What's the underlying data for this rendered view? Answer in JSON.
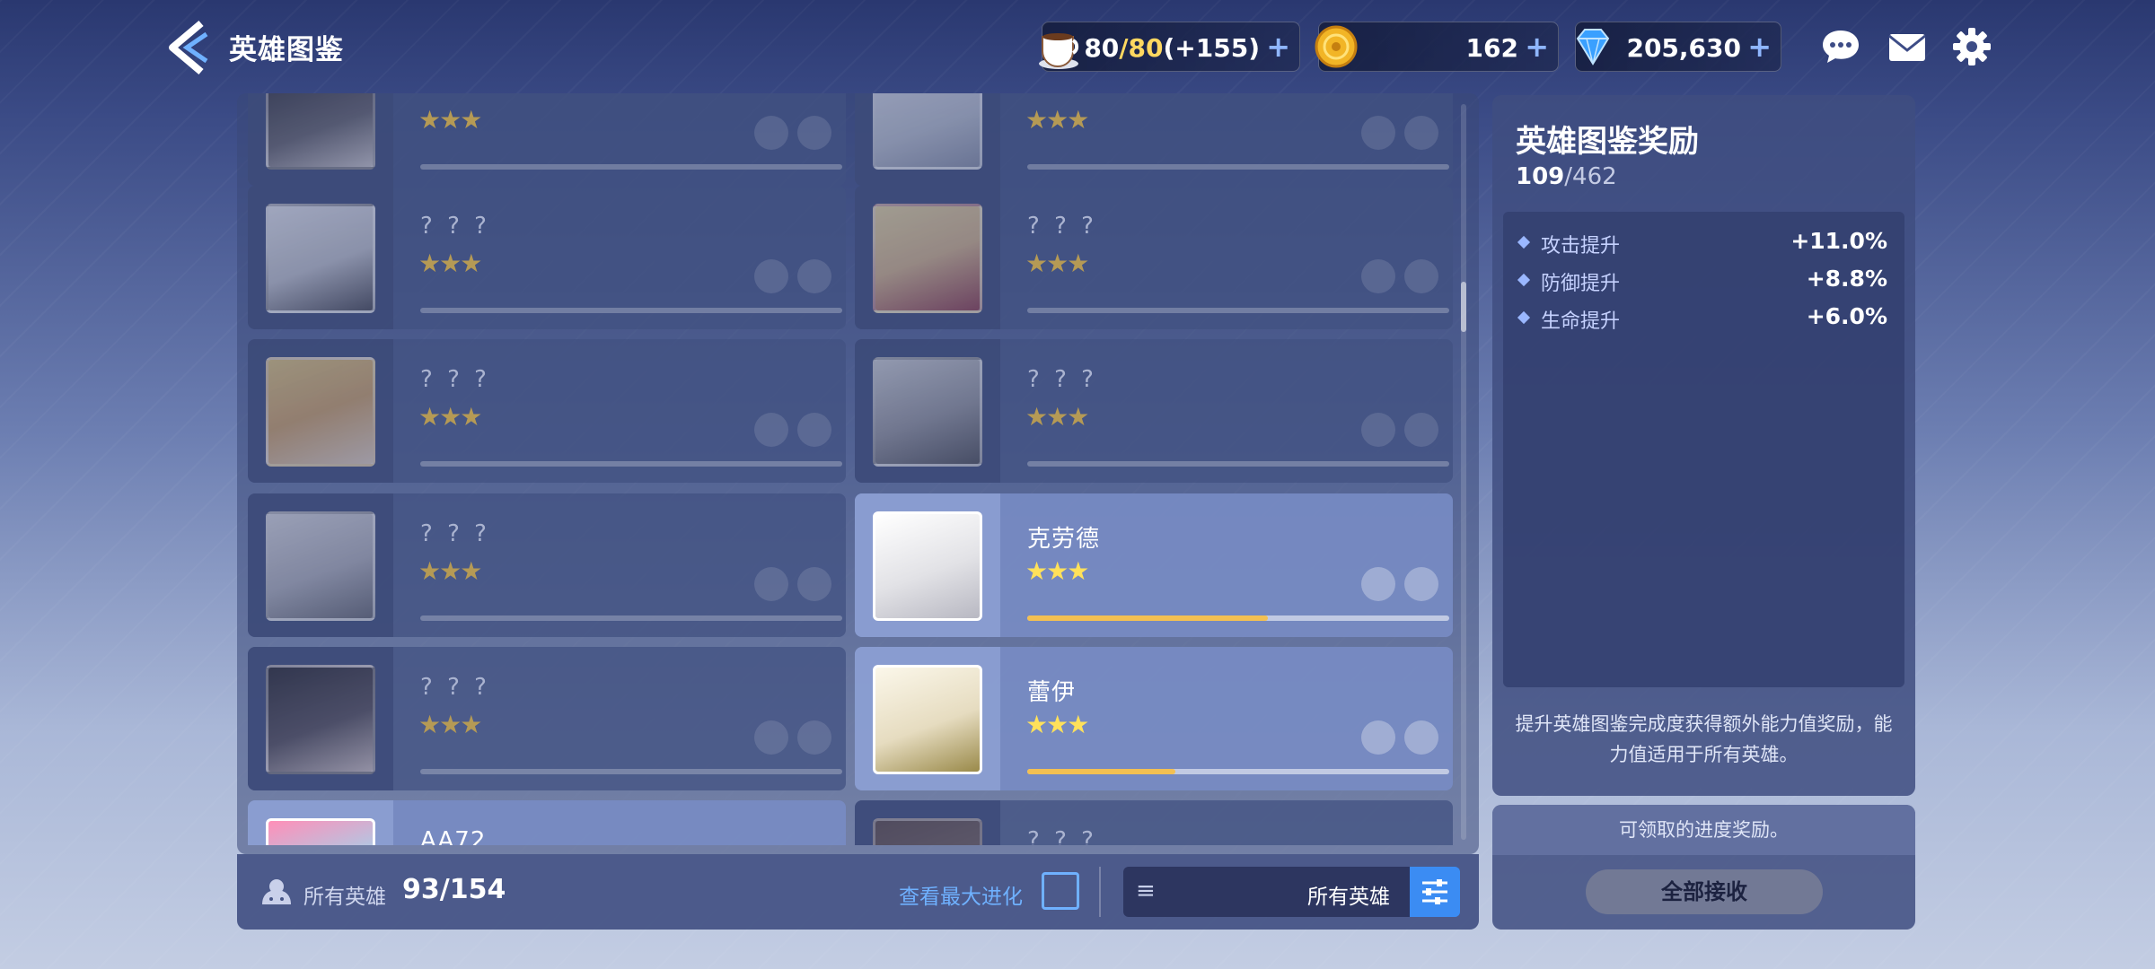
{
  "header": {
    "title": "英雄图鉴",
    "stamina": {
      "current": "80",
      "cap": "/80",
      "bonus": "(+155)",
      "plus": "+"
    },
    "gold": {
      "value": "162",
      "plus": "+"
    },
    "gems": {
      "value": "205,630",
      "plus": "+"
    }
  },
  "heroes": [
    {
      "name": "? ? ?",
      "stars": "★★★",
      "owned": false,
      "progress": 0
    },
    {
      "name": "? ? ?",
      "stars": "★★★",
      "owned": false,
      "progress": 0
    },
    {
      "name": "? ? ?",
      "stars": "★★★",
      "owned": false,
      "progress": 0
    },
    {
      "name": "? ? ?",
      "stars": "★★★",
      "owned": false,
      "progress": 0
    },
    {
      "name": "? ? ?",
      "stars": "★★★",
      "owned": false,
      "progress": 0
    },
    {
      "name": "? ? ?",
      "stars": "★★★",
      "owned": false,
      "progress": 0
    },
    {
      "name": "? ? ?",
      "stars": "★★★",
      "owned": false,
      "progress": 0
    },
    {
      "name": "克劳德",
      "stars": "★★★",
      "owned": true,
      "progress": 0.57
    },
    {
      "name": "? ? ?",
      "stars": "★★★",
      "owned": false,
      "progress": 0
    },
    {
      "name": "蕾伊",
      "stars": "★★★",
      "owned": true,
      "progress": 0.35
    },
    {
      "name": "AA72",
      "stars": "",
      "owned": true,
      "progress": 0
    },
    {
      "name": "? ? ?",
      "stars": "",
      "owned": false,
      "progress": 0
    }
  ],
  "footer": {
    "all_label": "所有英雄",
    "count": "93/154",
    "max_evo_label": "查看最大进化",
    "filter_label": "所有英雄"
  },
  "reward_panel": {
    "title": "英雄图鉴奖励",
    "progress_current": "109",
    "progress_total": "/462",
    "stats": [
      {
        "label": "攻击提升",
        "value": "+11.0%"
      },
      {
        "label": "防御提升",
        "value": "+8.8%"
      },
      {
        "label": "生命提升",
        "value": "+6.0%"
      }
    ],
    "description": "提升英雄图鉴完成度获得额外能力值奖励，能力值适用于所有英雄。",
    "claimable_text": "可领取的进度奖励。",
    "claim_all_button": "全部接收"
  },
  "colors": {
    "accent": "#3b8cf3",
    "progress": "#f3c052",
    "star": "#ffe15a"
  }
}
